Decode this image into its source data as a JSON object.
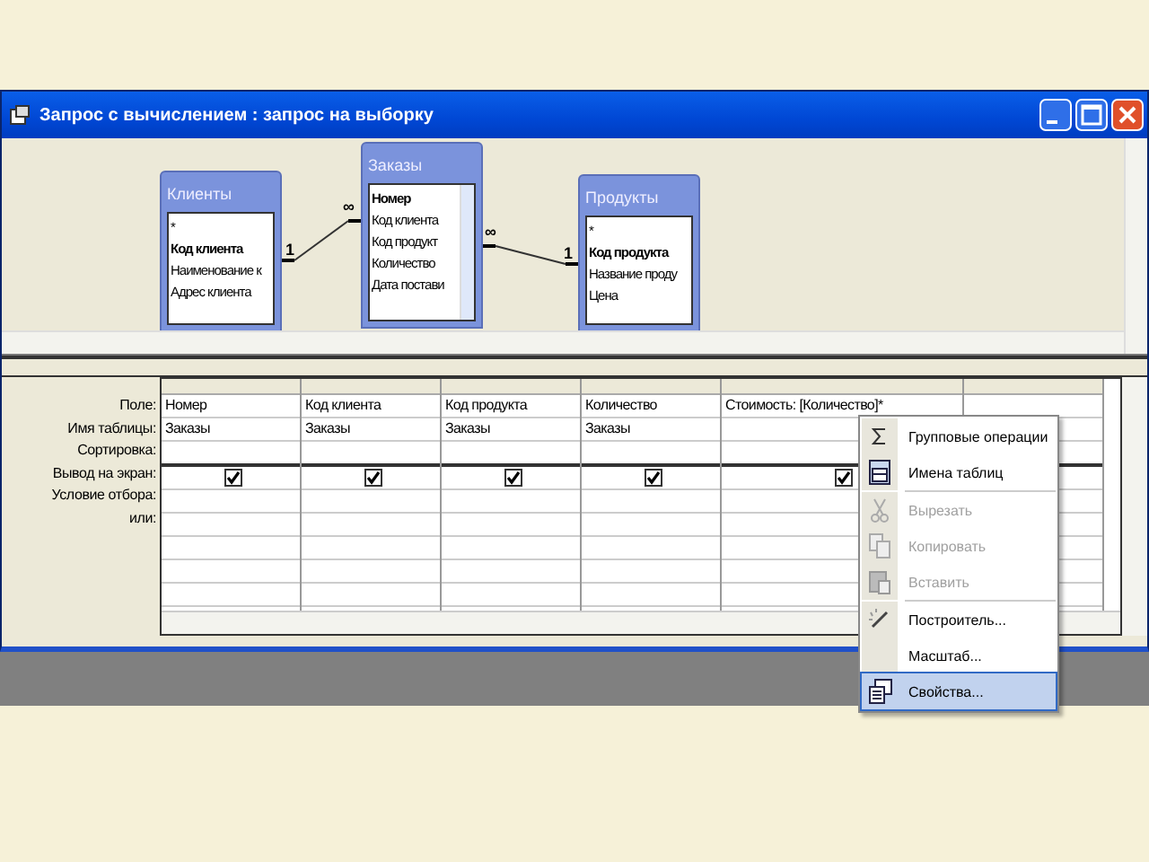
{
  "window": {
    "title": "Запрос с вычислением : запрос на выборку"
  },
  "diagram": {
    "tables": [
      {
        "name": "Клиенты",
        "fields": [
          {
            "name": "*",
            "key": false
          },
          {
            "name": "Код клиента",
            "key": true
          },
          {
            "name": "Наименование к",
            "key": false
          },
          {
            "name": "Адрес клиента",
            "key": false
          }
        ]
      },
      {
        "name": "Заказы",
        "fields": [
          {
            "name": "Номер",
            "key": true
          },
          {
            "name": "Код клиента",
            "key": false
          },
          {
            "name": "Код продукт",
            "key": false
          },
          {
            "name": "Количество",
            "key": false
          },
          {
            "name": "Дата постави",
            "key": false
          }
        ]
      },
      {
        "name": "Продукты",
        "fields": [
          {
            "name": "*",
            "key": false
          },
          {
            "name": "Код продукта",
            "key": true
          },
          {
            "name": "Название проду",
            "key": false
          },
          {
            "name": "Цена",
            "key": false
          }
        ]
      }
    ],
    "joins": [
      {
        "one": "1",
        "many": "∞"
      },
      {
        "one": "1",
        "many": "∞"
      }
    ]
  },
  "grid": {
    "row_labels": [
      "Поле:",
      "Имя таблицы:",
      "Сортировка:",
      "Вывод на экран:",
      "Условие отбора:",
      "или:"
    ],
    "columns": [
      {
        "field": "Номер",
        "table": "Заказы",
        "show": true
      },
      {
        "field": "Код клиента",
        "table": "Заказы",
        "show": true
      },
      {
        "field": "Код продукта",
        "table": "Заказы",
        "show": true
      },
      {
        "field": "Количество",
        "table": "Заказы",
        "show": true
      },
      {
        "field": "Стоимость: [Количество]*",
        "show": true
      }
    ]
  },
  "context_menu": {
    "items": [
      {
        "label": "Групповые операции",
        "disabled": false,
        "selected": false
      },
      {
        "label": "Имена таблиц",
        "disabled": false,
        "selected": false
      },
      {
        "label": "Вырезать",
        "disabled": true,
        "selected": false
      },
      {
        "label": "Копировать",
        "disabled": true,
        "selected": false
      },
      {
        "label": "Вставить",
        "disabled": true,
        "selected": false
      },
      {
        "label": "Построитель...",
        "disabled": false,
        "selected": false
      },
      {
        "label": "Масштаб...",
        "disabled": false,
        "selected": false
      },
      {
        "label": "Свойства...",
        "disabled": false,
        "selected": true
      }
    ]
  }
}
